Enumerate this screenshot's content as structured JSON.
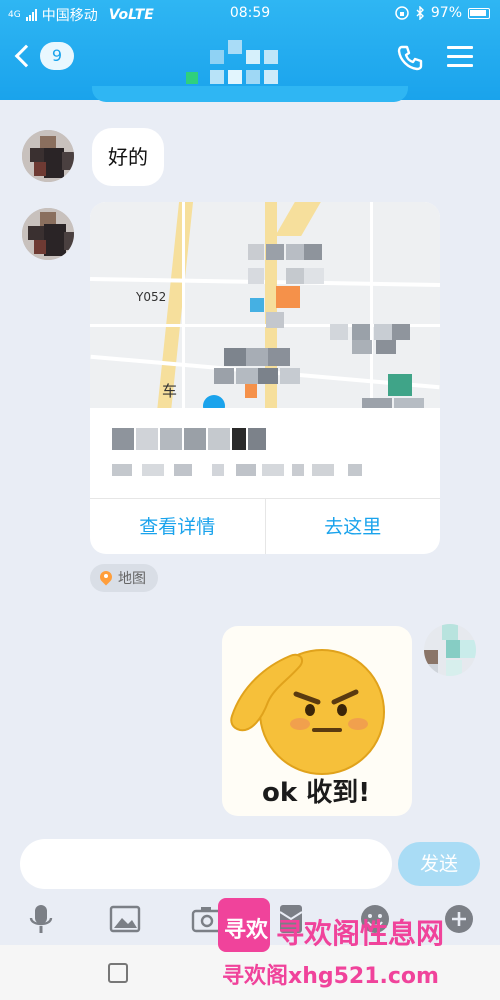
{
  "status_bar": {
    "network_tag": "4G",
    "carrier": "中国移动",
    "volte": "VoLTE",
    "time": "08:59",
    "battery": "97%"
  },
  "header": {
    "unread_count": "9"
  },
  "messages": {
    "text_reply": "好的",
    "map_card": {
      "road_label": "Y052",
      "road_label2": "车",
      "details_button": "查看详情",
      "go_button": "去这里"
    },
    "source_tag": "地图",
    "sticker_caption": "ok 收到!"
  },
  "composer": {
    "input_value": "",
    "send_label": "发送"
  },
  "watermark": {
    "logo_text": "寻欢",
    "title": "寻欢阁性息网",
    "url": "寻欢阁xhg521.com"
  },
  "colors": {
    "header": "#1aa3ec",
    "accent": "#1aa3ec",
    "watermark": "#f0439b"
  }
}
